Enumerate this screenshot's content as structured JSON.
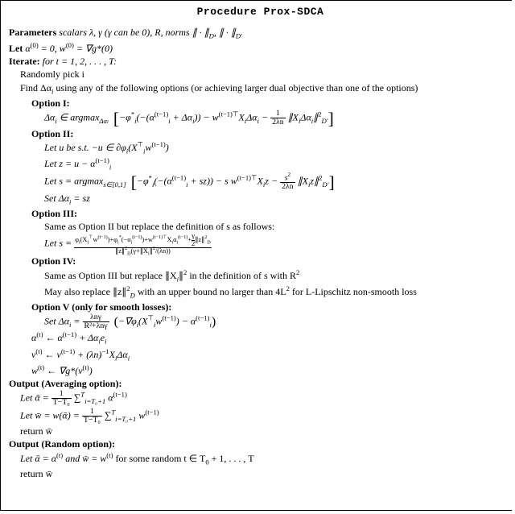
{
  "title": "Procedure Prox-SDCA",
  "params_label": "Parameters",
  "params_text": " scalars λ, γ (γ can be 0), R, norms ∥ · ∥",
  "params_sub1": "D",
  "params_sep": ", ∥ · ∥",
  "params_sub2": "D′",
  "let_label": "Let",
  "let_text": " α",
  "let_sup0": "(0)",
  "let_eq": " = 0, w",
  "let_eq2": " = ∇g*(0)",
  "iter_label": "Iterate:",
  "iter_text": " for t = 1, 2, . . . , T:",
  "pick": "Randomly pick i",
  "find": "Find Δα",
  "find_sub": "i",
  "find_tail": " using any of the following options (or achieving larger dual objective than one of the options)",
  "opt1": "Option I:",
  "opt1_lhs": "Δα",
  "opt1_in": " ∈ argmax",
  "opt1_argsub": "Δα",
  "opt1_body1": "−φ",
  "opt1_body2": "(−(α",
  "opt1_body3": " + Δα",
  "opt1_body4": ")) − w",
  "opt1_body5": "X",
  "opt1_body6": "Δα",
  "opt1_body7": " − ",
  "opt1_frac_num": "1",
  "opt1_frac_den": "2λn",
  "opt1_norm1": " ∥X",
  "opt1_norm2": "Δα",
  "opt1_norm3": "∥",
  "opt2": "Option II:",
  "opt2_l1a": "Let u be s.t. −u ∈ ∂φ",
  "opt2_l1b": "(X",
  "opt2_l1c": "w",
  "opt2_l1d": ")",
  "opt2_l2a": "Let z = u − α",
  "opt2_l3a": "Let s = argmax",
  "opt2_l3sub": "s∈[0,1]",
  "opt2_l3b": "−φ",
  "opt2_l3c": "(−(α",
  "opt2_l3d": " + sz)) − s w",
  "opt2_l3e": "X",
  "opt2_l3f": "z − ",
  "opt2_frac_num": "s",
  "opt2_frac_den": "2λn",
  "opt2_l3g": " ∥X",
  "opt2_l3h": "z∥",
  "opt2_l4": "Set Δα",
  "opt2_l4b": " = sz",
  "opt3": "Option III:",
  "opt3_l1": "Same as Option II but replace the definition of s as follows:",
  "opt3_l2a": "Let s = ",
  "opt3_num": "φᵢ(Xᵢ⊤w(t−1)) + φᵢ*(−αᵢ(t−1)) + w(t−1)⊤Xᵢαᵢ(t−1) + (γ/2)∥z∥²_D",
  "opt3_den": "∥z∥²_D (γ + ∥Xᵢ∥²/(λn))",
  "opt4": "Option IV:",
  "opt4_l1": "Same as Option III but replace ∥X",
  "opt4_l1b": "∥",
  "opt4_l1c": " in the definition of s with R",
  "opt4_l2a": "May also replace ∥z∥",
  "opt4_l2b": " with an upper bound no larger than 4L",
  "opt4_l2c": " for L-Lipschitz non-smooth loss",
  "opt5": "Option V (only for smooth losses):",
  "opt5_l1a": "Set Δα",
  "opt5_l1b": " = ",
  "opt5_frac_num": "λnγ",
  "opt5_frac_den": "R²+λnγ",
  "opt5_l1c": "−∇φ",
  "opt5_l1d": "(X",
  "opt5_l1e": "w",
  "opt5_l1f": ") − α",
  "upd1a": "α",
  "upd1b": " ← α",
  "upd1c": " + Δα",
  "upd1d": "e",
  "upd2a": "v",
  "upd2b": " ← v",
  "upd2c": " + (λn)",
  "upd2d": "X",
  "upd2e": "Δα",
  "upd3a": "w",
  "upd3b": " ← ∇g*(v",
  "upd3c": ")",
  "outAvg": "Output (Averaging option):",
  "avg1a": "Let ᾱ = ",
  "avg1_num": "1",
  "avg1_den": "T−T₀",
  "avg1b": " ∑",
  "avg1_sub": "i=T₀+1",
  "avg1_sup": "T",
  "avg1c": " α",
  "avg2a": "Let w̄ = w(ᾱ) = ",
  "avg2b": " ∑",
  "avg2c": " w",
  "ret": "return w̄",
  "outRnd": "Output (Random option):",
  "rnd1a": "Let ᾱ = α",
  "rnd1b": " and w̄ = w",
  "rnd1c": " for some random t ∈ T",
  "rnd1d": " + 1, . . . , T",
  "sup_t": "(t)",
  "sup_tm1": "(t−1)",
  "sup_T": "⊤",
  "sup_2": "2",
  "sup_m1": "−1",
  "sub_i": "i",
  "sub_D": "D",
  "sub_Dp": "D′",
  "sub_0": "0",
  "sup_star": "*"
}
